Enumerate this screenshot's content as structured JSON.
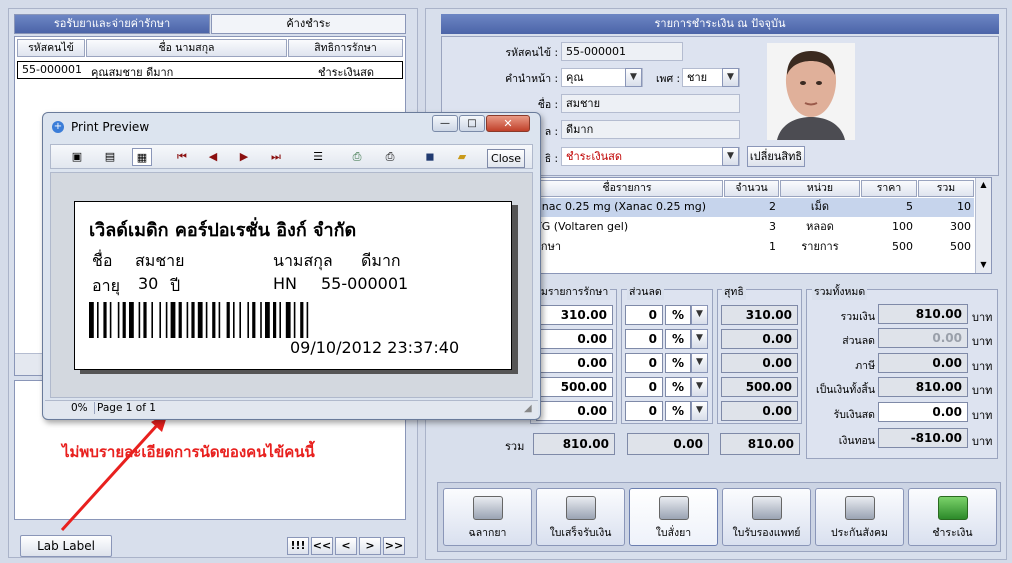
{
  "left": {
    "tabs": [
      "รอรับยาและจ่ายค่ารักษา",
      "ค้างชำระ"
    ],
    "columns": [
      "รหัสคนไข้",
      "ชื่อ นามสกุล",
      "สิทธิการรักษา"
    ],
    "rows": [
      [
        "55-000001",
        "คุณสมชาย ดีมาก",
        "ชำระเงินสด"
      ]
    ],
    "lab_label_button": "Lab Label",
    "nav": [
      "!!!",
      "<<",
      "<",
      ">",
      ">>"
    ],
    "annotation": "ไม่พบรายละเอียดการนัดของคนไข้คนนี้"
  },
  "right": {
    "title": "รายการชำระเงิน ณ ปัจจุบัน",
    "hn_label": "รหัสคนไข้ :",
    "hn": "55-000001",
    "prefix_label": "คำนำหน้า :",
    "prefix": "คุณ",
    "sex_label": "เพศ :",
    "sex": "ชาย",
    "first_label": "ชื่อ :",
    "first_name": "สมชาย",
    "last_label": "ล :",
    "last_name": "ดีมาก",
    "right_label": "ธิ :",
    "right_value": "ชำระเงินสด",
    "change_right_button": "เปลี่ยนสิทธิ",
    "item_columns": [
      "ชื่อรายการ",
      "จำนวน",
      "หน่วย",
      "ราคา",
      "รวม"
    ],
    "items": [
      {
        "name": "anac 0.25 mg (Xanac 0.25 mg)",
        "qty": "2",
        "unit": "เม็ด",
        "price": "5",
        "total": "10"
      },
      {
        "name": "TG (Voltaren gel)",
        "qty": "3",
        "unit": "หลอด",
        "price": "100",
        "total": "300"
      },
      {
        "name": "รักษา",
        "qty": "1",
        "unit": "รายการ",
        "price": "500",
        "total": "500"
      }
    ],
    "group_treatment": "ามรายการรักษา",
    "group_discount": "ส่วนลด",
    "group_net": "สุทธิ",
    "group_sum": "รวมทั้งหมด",
    "treatment_values": [
      "310.00",
      "0.00",
      "0.00",
      "500.00",
      "0.00"
    ],
    "discount_values": [
      "0",
      "0",
      "0",
      "0",
      "0"
    ],
    "discount_unit": "%",
    "net_values": [
      "310.00",
      "0.00",
      "0.00",
      "500.00",
      "0.00"
    ],
    "sum_row_label": "รวม",
    "sum_row": [
      "810.00",
      "0.00",
      "810.00"
    ],
    "totals": [
      {
        "label": "รวมเงิน",
        "value": "810.00",
        "unit": "บาท"
      },
      {
        "label": "ส่วนลด",
        "value": "0.00",
        "unit": "บาท"
      },
      {
        "label": "ภาษี",
        "value": "0.00",
        "unit": "บาท"
      },
      {
        "label": "เป็นเงินทั้งสิ้น",
        "value": "810.00",
        "unit": "บาท"
      },
      {
        "label": "รับเงินสด",
        "value": "0.00",
        "unit": "บาท"
      },
      {
        "label": "เงินทอน",
        "value": "-810.00",
        "unit": "บาท"
      }
    ],
    "actions": [
      "ฉลากยา",
      "ใบเสร็จรับเงิน",
      "ใบสั่งยา",
      "ใบรับรองแพทย์",
      "ประกันสังคม",
      "ชำระเงิน"
    ]
  },
  "dialog": {
    "title": "Print Preview",
    "close_button": "Close",
    "status_zoom": "0%",
    "status_page": "Page 1 of 1",
    "label": {
      "company": "เวิลด์เมดิก คอร์ปอเรชั่น อิงก์ จำกัด",
      "name_label": "ชื่อ",
      "name": "สมชาย",
      "surname_label": "นามสกุล",
      "surname": "ดีมาก",
      "age_label": "อายุ",
      "age": "30",
      "age_unit": "ปี",
      "hn_label": "HN",
      "hn": "55-000001",
      "datetime": "09/10/2012 23:37:40"
    }
  },
  "colors": {
    "annotation": "#e8201e",
    "header_blue": "#4b64a8"
  }
}
